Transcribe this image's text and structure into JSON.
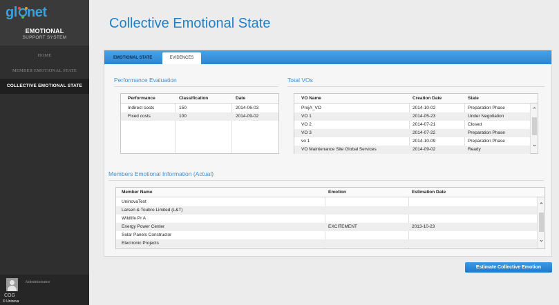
{
  "app": {
    "logo_text": "globnet",
    "title": "EMOTIONAL",
    "subtitle": "SUPPORT SYSTEM"
  },
  "sidebar": {
    "items": [
      {
        "label": "HOME",
        "active": false
      },
      {
        "label": "MEMBER EMOTIONAL STATE",
        "active": false
      },
      {
        "label": "COLLECTIVE EMOTIONAL STATE",
        "active": true
      }
    ],
    "user": {
      "name": "Administrator",
      "role": "COG",
      "copyright": "© Uninova",
      "avatar_icon": "user-avatar-icon"
    }
  },
  "page": {
    "title": "Collective Emotional State"
  },
  "tabs": [
    {
      "label": "EMOTIONAL STATE",
      "active": false
    },
    {
      "label": "EVIDENCES",
      "active": true
    }
  ],
  "performance": {
    "title": "Performance Evaluation",
    "columns": [
      "Performance",
      "Classification",
      "Date"
    ],
    "rows": [
      [
        "Indirect costs",
        "150",
        "2014-06-03"
      ],
      [
        "Fixed costs",
        "100",
        "2014-09-02"
      ]
    ]
  },
  "vos": {
    "title": "Total VOs",
    "columns": [
      "VO Name",
      "Creation Date",
      "State"
    ],
    "rows": [
      [
        "ProjA_VO",
        "2014-10-02",
        "Preparation Phase"
      ],
      [
        "VO 1",
        "2014-05-23",
        "Under Negotiation"
      ],
      [
        "VO 2",
        "2014-07-21",
        "Closed"
      ],
      [
        "VO 3",
        "2014-07-22",
        "Preparation Phase"
      ],
      [
        "vo 1",
        "2014-10-09",
        "Preparation Phase"
      ],
      [
        "VO Maintenance Site Global Services",
        "2014-09-02",
        "Ready"
      ]
    ]
  },
  "members": {
    "title": "Members Emotional Information (Actual)",
    "columns": [
      "Member Name",
      "Emotion",
      "Estimation Date"
    ],
    "rows": [
      [
        "UninovaTest",
        "",
        ""
      ],
      [
        "Larsen & Toubro Limited (L&T)",
        "",
        ""
      ],
      [
        "Wildlife Pr A",
        "",
        ""
      ],
      [
        "Energy Power Center",
        "EXCITEMENT",
        "2013-10-23"
      ],
      [
        "Solar Panels Constructor",
        "",
        ""
      ],
      [
        "Electronic Projects",
        "",
        ""
      ]
    ]
  },
  "actions": {
    "estimate_label": "Estimate Collective Emotion"
  },
  "colors": {
    "accent": "#1e80c8",
    "sidebar_bg": "#2f2f2f",
    "tabbar": "#2c86d0"
  }
}
